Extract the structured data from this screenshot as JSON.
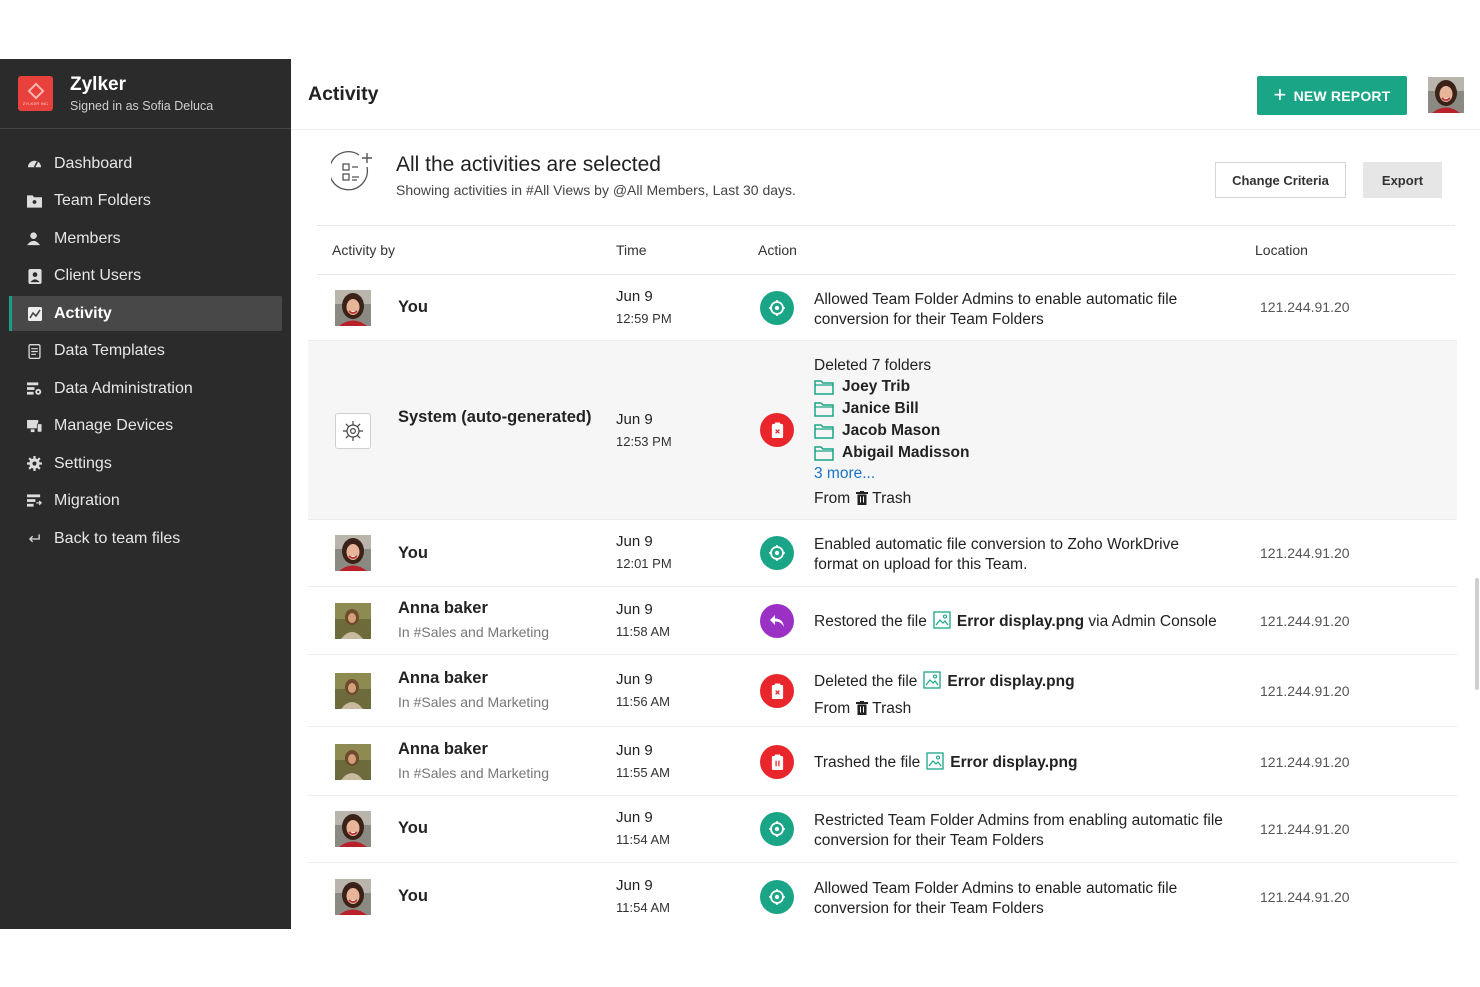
{
  "brand": {
    "name": "Zylker",
    "signed_in": "Signed in as Sofia Deluca",
    "logo_text": "ZYLKER INC"
  },
  "sidebar": {
    "items": [
      {
        "label": "Dashboard",
        "icon": "dashboard-icon"
      },
      {
        "label": "Team Folders",
        "icon": "team-folders-icon"
      },
      {
        "label": "Members",
        "icon": "members-icon"
      },
      {
        "label": "Client Users",
        "icon": "client-users-icon"
      },
      {
        "label": "Activity",
        "icon": "activity-icon",
        "active": true
      },
      {
        "label": "Data Templates",
        "icon": "data-templates-icon"
      },
      {
        "label": "Data Administration",
        "icon": "data-administration-icon"
      },
      {
        "label": "Manage Devices",
        "icon": "manage-devices-icon"
      },
      {
        "label": "Settings",
        "icon": "settings-icon"
      },
      {
        "label": "Migration",
        "icon": "migration-icon"
      },
      {
        "label": "Back to team files",
        "icon": "back-icon"
      }
    ]
  },
  "header": {
    "title": "Activity",
    "new_report": "NEW REPORT"
  },
  "summary": {
    "title": "All the activities are selected",
    "subtitle": "Showing activities in #All Views by @All Members, Last 30 days.",
    "change_criteria": "Change Criteria",
    "export": "Export"
  },
  "table": {
    "columns": {
      "activity_by": "Activity by",
      "time": "Time",
      "action": "Action",
      "location": "Location"
    },
    "rows": [
      {
        "who": "You",
        "date": "Jun 9",
        "time": "12:59 PM",
        "action": "Allowed Team Folder Admins to enable automatic file conversion for their Team Folders",
        "location": "121.244.91.20"
      },
      {
        "who": "System (auto-generated)",
        "date": "Jun 9",
        "time": "12:53 PM",
        "action_title": "Deleted 7 folders",
        "folders": [
          "Joey Trib",
          "Janice Bill",
          "Jacob Mason",
          "Abigail Madisson"
        ],
        "more": "3 more...",
        "from_label": "From",
        "trash": "Trash"
      },
      {
        "who": "You",
        "date": "Jun 9",
        "time": "12:01 PM",
        "action": "Enabled automatic file conversion to Zoho WorkDrive format on upload for this Team.",
        "location": "121.244.91.20"
      },
      {
        "who": "Anna baker",
        "team": "In #Sales and Marketing",
        "date": "Jun 9",
        "time": "11:58 AM",
        "pre": "Restored the file",
        "file": "Error display.png",
        "post": "via Admin Console",
        "location": "121.244.91.20"
      },
      {
        "who": "Anna baker",
        "team": "In #Sales and Marketing",
        "date": "Jun 9",
        "time": "11:56 AM",
        "pre": "Deleted the file",
        "file": "Error display.png",
        "from_label": "From",
        "trash": "Trash",
        "location": "121.244.91.20"
      },
      {
        "who": "Anna baker",
        "team": "In #Sales and Marketing",
        "date": "Jun 9",
        "time": "11:55 AM",
        "pre": "Trashed the file",
        "file": "Error display.png",
        "location": "121.244.91.20"
      },
      {
        "who": "You",
        "date": "Jun 9",
        "time": "11:54 AM",
        "action": "Restricted Team Folder Admins from enabling automatic file conversion for their Team Folders",
        "location": "121.244.91.20"
      },
      {
        "who": "You",
        "date": "Jun 9",
        "time": "11:54 AM",
        "action": "Allowed Team Folder Admins to enable automatic file conversion for their Team Folders",
        "location": "121.244.91.20"
      }
    ]
  },
  "colors": {
    "accent": "#1aa587",
    "danger": "#e8262c",
    "restore": "#9b31c4",
    "sidebar_bg": "#2b2b2b"
  }
}
